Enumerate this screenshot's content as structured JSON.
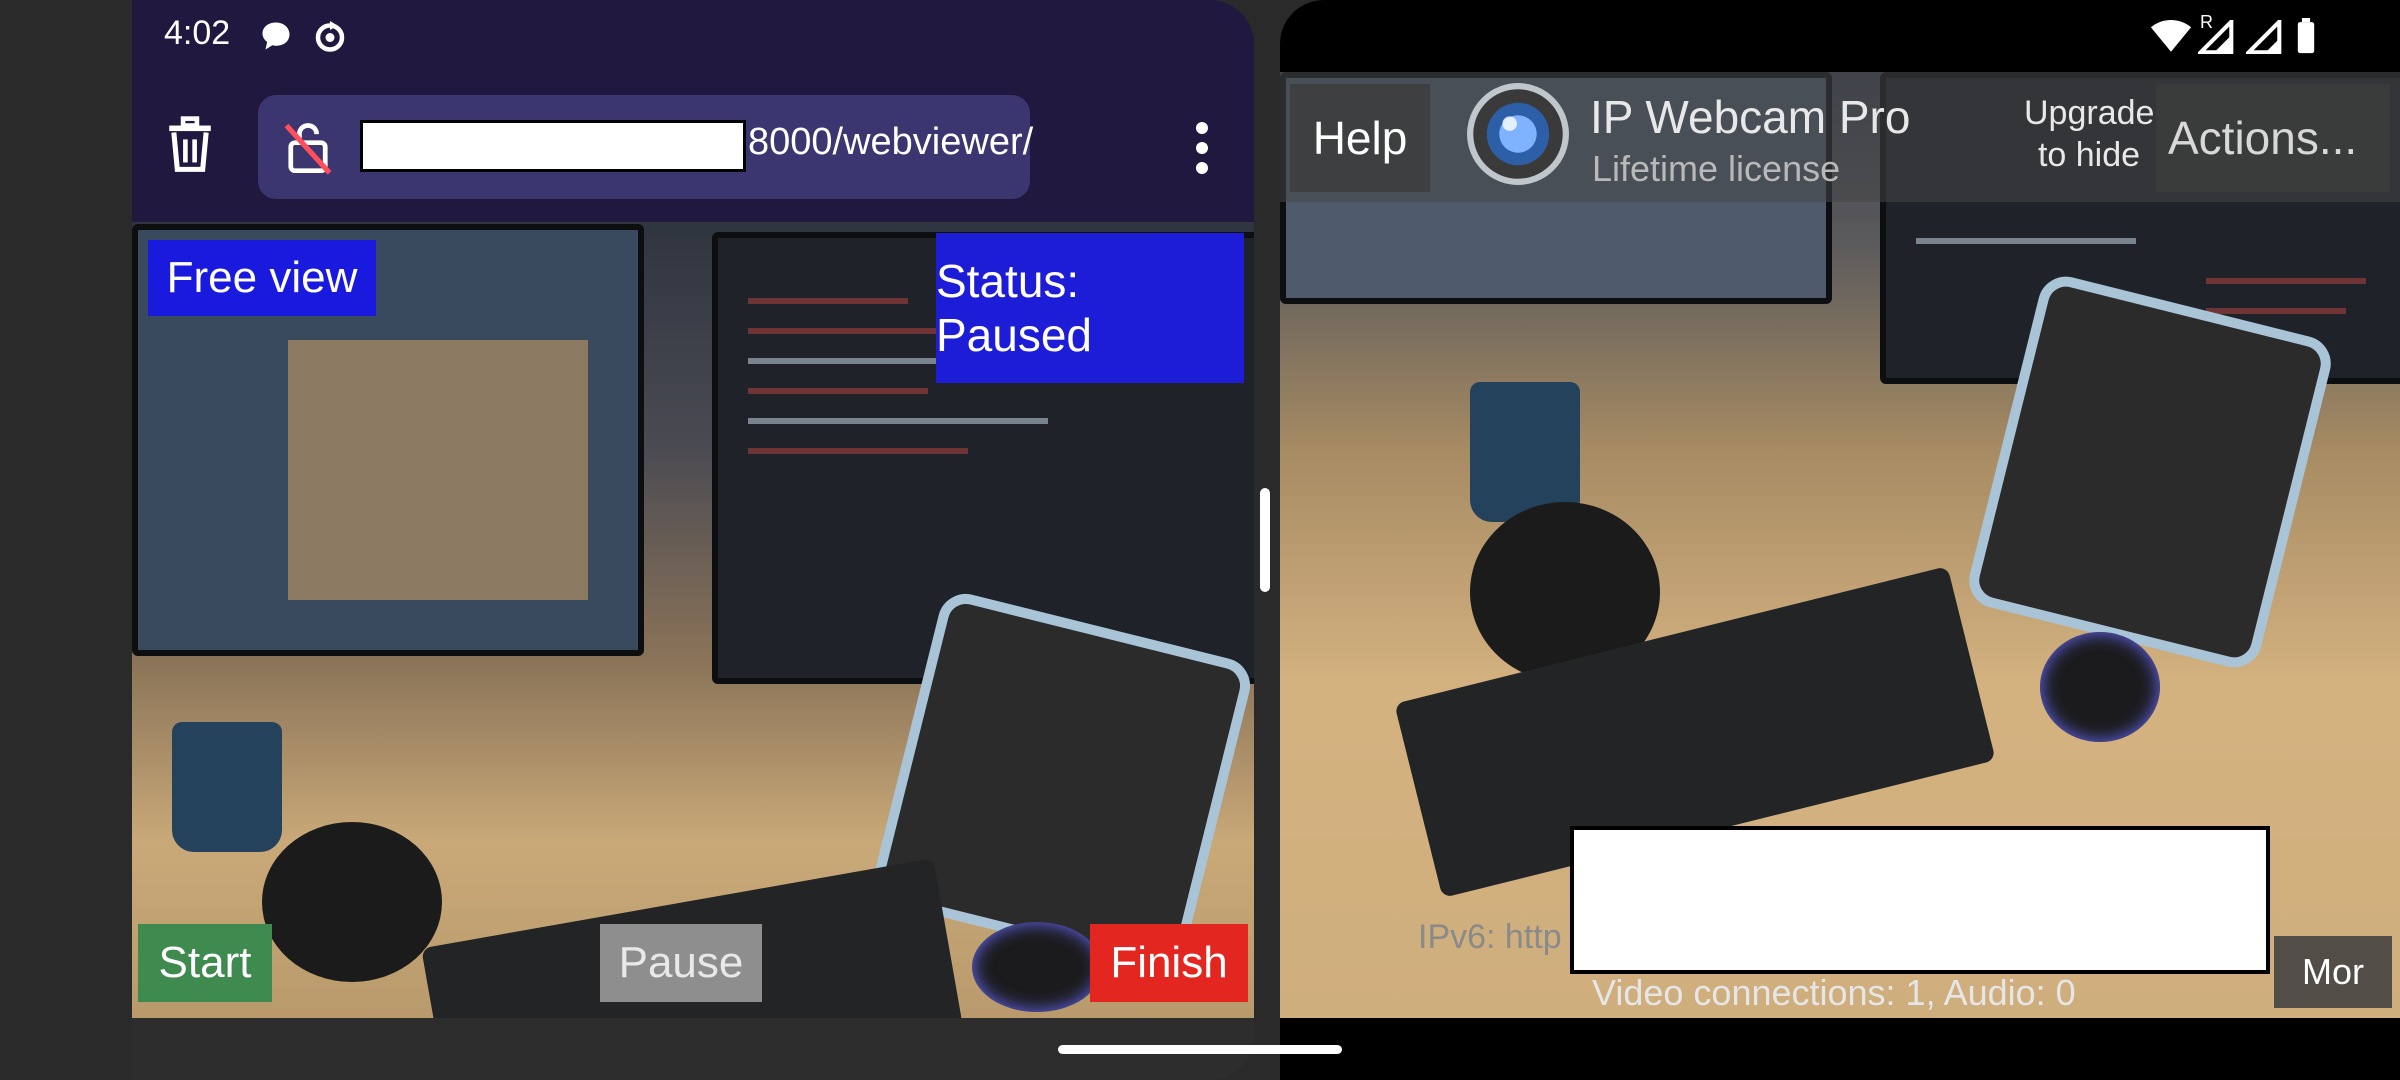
{
  "status_bar": {
    "time": "4:02",
    "left_icons": [
      "chat-bubble-icon",
      "sync-icon"
    ],
    "right_icons": [
      "wifi-icon",
      "signal-roaming-icon",
      "signal-icon",
      "battery-icon"
    ],
    "roaming_label": "R"
  },
  "browser": {
    "url_visible": "8000/webviewer/",
    "toolbar_icons": [
      "trash-icon",
      "insecure-lock-icon",
      "more-vert-icon"
    ]
  },
  "webviewer": {
    "free_view_label": "Free view",
    "status_label": "Status: Paused",
    "start_label": "Start",
    "pause_label": "Pause",
    "finish_label": "Finish"
  },
  "ipwebcam": {
    "help_label": "Help",
    "app_name": "IP Webcam Pro",
    "license_text": "Lifetime license",
    "upgrade_label": "Upgrade to hide",
    "actions_label": "Actions...",
    "ipv6_text": "IPv6: http",
    "connections_text": "Video connections: 1, Audio: 0",
    "more_label": "Mor"
  },
  "colors": {
    "browser_toolbar": "#20183f",
    "url_bar": "#3b3570",
    "free_view_bg": "#1a1adf",
    "status_bg": "#1d1dd8",
    "start_bg": "#3f8a4f",
    "pause_bg": "#8e8e8e",
    "finish_bg": "#e3261f"
  }
}
